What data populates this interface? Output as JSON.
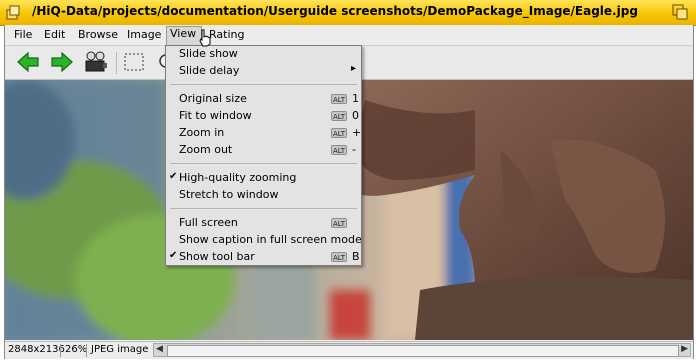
{
  "window": {
    "title": "/HiQ-Data/projects/documentation/Userguide screenshots/DemoPackage_Image/Eagle.jpg"
  },
  "menubar": [
    "File",
    "Edit",
    "Browse",
    "Image",
    "View",
    "Rating"
  ],
  "toolbar": {
    "icons": [
      "back-arrow-icon",
      "forward-arrow-icon",
      "slideshow-projector-icon",
      "selection-rect-icon",
      "zoom-icon"
    ]
  },
  "view_menu": {
    "items": [
      {
        "label": "Slide show"
      },
      {
        "label": "Slide delay",
        "submenu": true
      },
      {
        "label": "Original size",
        "modifier": "ALT",
        "key": "1"
      },
      {
        "label": "Fit to window",
        "modifier": "ALT",
        "key": "0"
      },
      {
        "label": "Zoom in",
        "modifier": "ALT",
        "key": "+"
      },
      {
        "label": "Zoom out",
        "modifier": "ALT",
        "key": "-"
      },
      {
        "label": "High-quality zooming",
        "checked": true
      },
      {
        "label": "Stretch to window"
      },
      {
        "label": "Full screen",
        "modifier": "ALT"
      },
      {
        "label": "Show caption in full screen mode"
      },
      {
        "label": "Show tool bar",
        "checked": true,
        "modifier": "ALT",
        "key": "B"
      }
    ]
  },
  "statusbar": {
    "dimensions": "2848x2136",
    "zoom": "26%",
    "type": "JPEG image"
  },
  "colors": {
    "titlebar": "#f5c400",
    "toolbar_arrow": "#2bb32b"
  }
}
